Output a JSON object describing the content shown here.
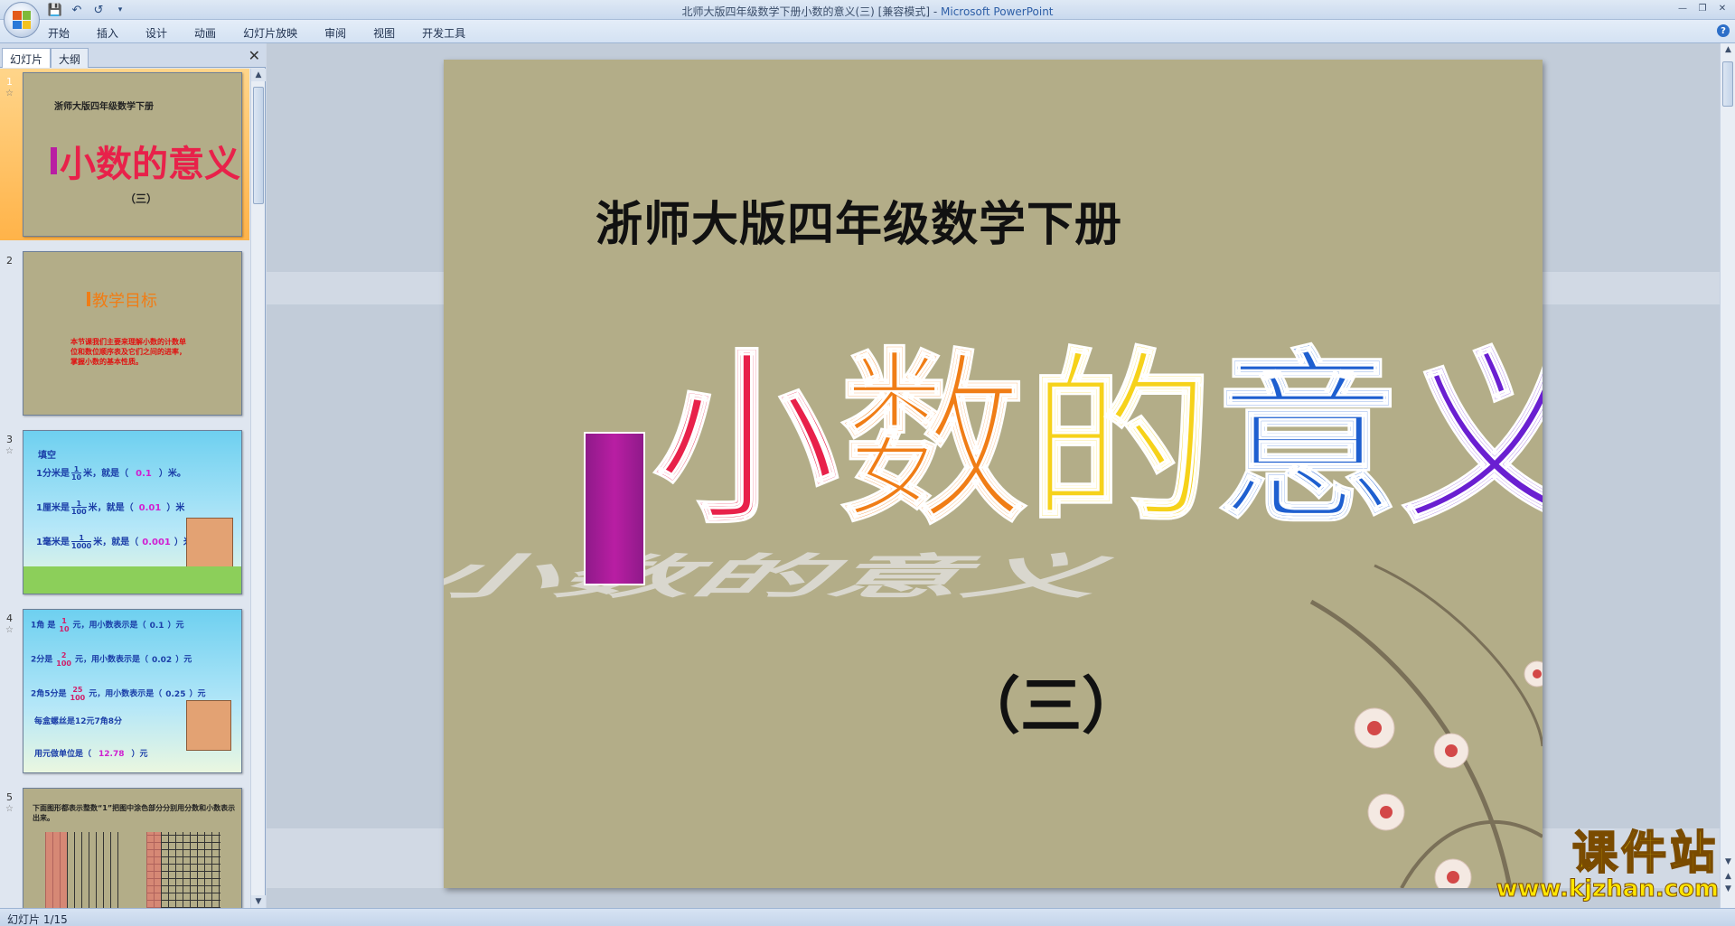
{
  "window": {
    "title_doc": "北师大版四年级数学下册小数的意义(三) [兼容模式] - ",
    "title_app": "Microsoft PowerPoint"
  },
  "ribbon": {
    "tabs": [
      "开始",
      "插入",
      "设计",
      "动画",
      "幻灯片放映",
      "审阅",
      "视图",
      "开发工具"
    ]
  },
  "panel": {
    "tab_slides": "幻灯片",
    "tab_outline": "大纲"
  },
  "thumbnails": [
    {
      "num": "1",
      "line1": "浙师大版四年级数学下册",
      "title": "小数的意义",
      "sub": "（三）"
    },
    {
      "num": "2",
      "title": "教学目标",
      "body": "本节课我们主要来理解小数的计数单位和数位顺序表及它们之间的进率，掌握小数的基本性质。"
    },
    {
      "num": "3",
      "heading": "填空",
      "l1": "1分米是",
      "f1n": "1",
      "f1d": "10",
      "l1b": "米，就是（",
      "a1": "0.1",
      "l1c": "）米。",
      "l2": "1厘米是",
      "f2n": "1",
      "f2d": "100",
      "l2b": "米，就是（",
      "a2": "0.01",
      "l2c": "）米",
      "l3": "1毫米是",
      "f3n": "1",
      "f3d": "1000",
      "l3b": "米，就是（",
      "a3": "0.001",
      "l3c": "）米"
    },
    {
      "num": "4",
      "r1a": "1角 是",
      "r1n": "1",
      "r1d": "10",
      "r1b": "元，用小数表示是（",
      "r1v": "0.1",
      "r1c": "）元",
      "r2a": "2分是",
      "r2n": "2",
      "r2d": "100",
      "r2b": "元，用小数表示是（",
      "r2v": "0.02",
      "r2c": "）元",
      "r3a": "2角5分是",
      "r3n": "25",
      "r3d": "100",
      "r3b": "元，用小数表示是（",
      "r3v": "0.25",
      "r3c": "）元",
      "r4": "每盒螺丝是12元7角8分",
      "r5a": "用元做单位是（",
      "r5v": "12.78",
      "r5c": "）元"
    },
    {
      "num": "5",
      "text": "下面图形都表示整数“1”把图中涂色部分分别用分数和小数表示出来。"
    }
  ],
  "slide": {
    "subtitle_top": "浙师大版四年级数学下册",
    "title_chars": [
      "小",
      "数",
      "的",
      "意",
      "义"
    ],
    "title_colors": [
      "#e8214a",
      "#f07d16",
      "#f6d21a",
      "#1e5fd0",
      "#6a1fd1"
    ],
    "part": "（三）"
  },
  "status": {
    "text": "幻灯片 1/15"
  },
  "watermark": {
    "big": "课件站",
    "url": "www.kjzhan.com"
  }
}
